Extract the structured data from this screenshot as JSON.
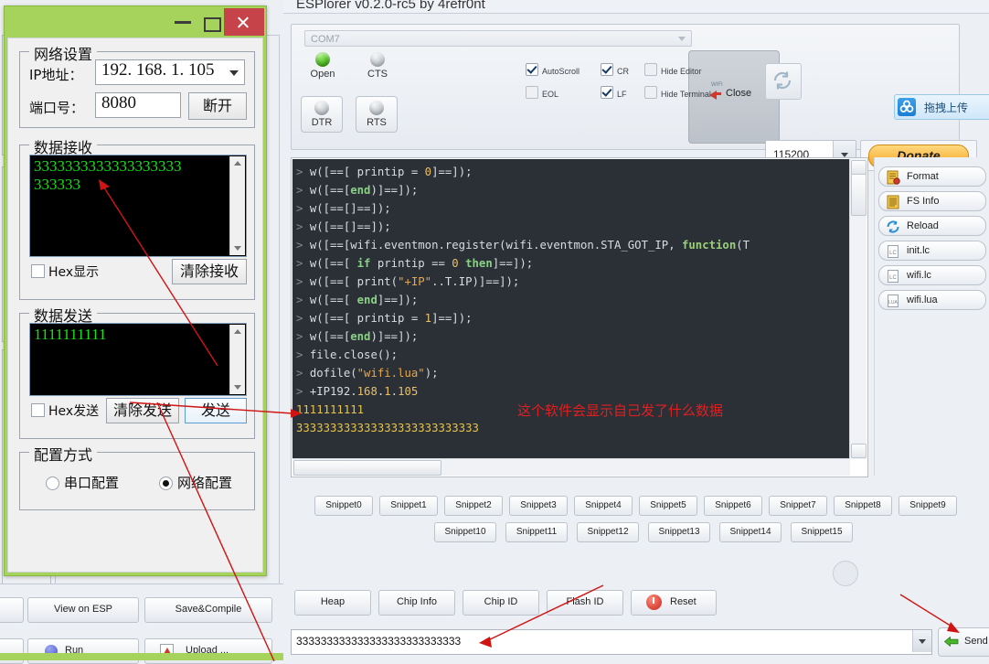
{
  "esplorer": {
    "title": "ESPlorer v0.2.0-rc5 by 4refr0nt",
    "port_select": "COM7",
    "leds": [
      {
        "name": "Open",
        "state": "green"
      },
      {
        "name": "CTS",
        "state": "grey"
      },
      {
        "name": "DTR",
        "state": "grey"
      },
      {
        "name": "RTS",
        "state": "grey"
      }
    ],
    "close_button": "Close",
    "baud": "115200",
    "donate": "Donate",
    "checkboxes": [
      {
        "label": "AutoScroll",
        "checked": true
      },
      {
        "label": "EOL",
        "checked": false
      },
      {
        "label": "CR",
        "checked": true
      },
      {
        "label": "LF",
        "checked": true
      },
      {
        "label": "Hide Editor",
        "checked": false
      },
      {
        "label": "Hide Terminal",
        "checked": false
      }
    ],
    "drag_upload": "拖拽上传",
    "file_buttons": [
      {
        "label": "Format",
        "icon": "format-icon"
      },
      {
        "label": "FS Info",
        "icon": "fsinfo-icon"
      },
      {
        "label": "Reload",
        "icon": "reload-icon"
      },
      {
        "label": "init.lc",
        "icon": "lc-file-icon"
      },
      {
        "label": "wifi.lc",
        "icon": "lc-file-icon"
      },
      {
        "label": "wifi.lua",
        "icon": "lua-file-icon"
      }
    ],
    "snippets_row1": [
      "Snippet0",
      "Snippet1",
      "Snippet2",
      "Snippet3",
      "Snippet4",
      "Snippet5",
      "Snippet6",
      "Snippet7",
      "Snippet8",
      "Snippet9"
    ],
    "snippets_row2": [
      "Snippet10",
      "Snippet11",
      "Snippet12",
      "Snippet13",
      "Snippet14",
      "Snippet15"
    ],
    "bottom_buttons": [
      "Heap",
      "Chip Info",
      "Chip ID",
      "Flash ID"
    ],
    "reset_button": "Reset",
    "send_field_value": "333333333333333333333333333",
    "send_button": "Send"
  },
  "terminal": {
    "lines": [
      {
        "prompt": ">",
        "parts": [
          {
            "t": "w([==[    printip = ",
            "c": "plain"
          },
          {
            "t": "0",
            "c": "num"
          },
          {
            "t": "]==]);",
            "c": "plain"
          }
        ]
      },
      {
        "prompt": ">",
        "parts": [
          {
            "t": "w([==[",
            "c": "plain"
          },
          {
            "t": "end",
            "c": "kw"
          },
          {
            "t": ")]==]);",
            "c": "plain"
          }
        ]
      },
      {
        "prompt": ">",
        "parts": [
          {
            "t": "w([==[]==]);",
            "c": "plain"
          }
        ]
      },
      {
        "prompt": ">",
        "parts": [
          {
            "t": "w([==[]==]);",
            "c": "plain"
          }
        ]
      },
      {
        "prompt": ">",
        "parts": [
          {
            "t": "w([==[wifi.eventmon.register(wifi.eventmon.STA_GOT_IP, ",
            "c": "plain"
          },
          {
            "t": "function",
            "c": "fn"
          },
          {
            "t": "(T",
            "c": "plain"
          }
        ]
      },
      {
        "prompt": ">",
        "parts": [
          {
            "t": "w([==[    ",
            "c": "plain"
          },
          {
            "t": "if",
            "c": "kw"
          },
          {
            "t": " printip == ",
            "c": "plain"
          },
          {
            "t": "0",
            "c": "num"
          },
          {
            "t": " ",
            "c": "plain"
          },
          {
            "t": "then",
            "c": "kw"
          },
          {
            "t": "]==]);",
            "c": "plain"
          }
        ]
      },
      {
        "prompt": ">",
        "parts": [
          {
            "t": "w([==[        print(",
            "c": "plain"
          },
          {
            "t": "\"+IP\"",
            "c": "str"
          },
          {
            "t": "..T.IP)]==]);",
            "c": "plain"
          }
        ]
      },
      {
        "prompt": ">",
        "parts": [
          {
            "t": "w([==[    ",
            "c": "plain"
          },
          {
            "t": "end",
            "c": "kw"
          },
          {
            "t": "]==]);",
            "c": "plain"
          }
        ]
      },
      {
        "prompt": ">",
        "parts": [
          {
            "t": "w([==[    printip = ",
            "c": "plain"
          },
          {
            "t": "1",
            "c": "num"
          },
          {
            "t": "]==]);",
            "c": "plain"
          }
        ]
      },
      {
        "prompt": ">",
        "parts": [
          {
            "t": "w([==[",
            "c": "plain"
          },
          {
            "t": "end",
            "c": "kw"
          },
          {
            "t": ")]==]);",
            "c": "plain"
          }
        ]
      },
      {
        "prompt": ">",
        "parts": [
          {
            "t": "file.close();",
            "c": "plain"
          }
        ]
      },
      {
        "prompt": ">",
        "parts": [
          {
            "t": "dofile(",
            "c": "plain"
          },
          {
            "t": "\"wifi.lua\"",
            "c": "str"
          },
          {
            "t": ");",
            "c": "plain"
          }
        ]
      },
      {
        "prompt": ">",
        "parts": [
          {
            "t": "+IP192.",
            "c": "plain"
          },
          {
            "t": "168",
            "c": "num"
          },
          {
            "t": ".",
            "c": "plain"
          },
          {
            "t": "1",
            "c": "num"
          },
          {
            "t": ".",
            "c": "plain"
          },
          {
            "t": "105",
            "c": "num"
          }
        ]
      },
      {
        "prompt": "",
        "parts": [
          {
            "t": "1111111111",
            "c": "sent"
          }
        ]
      },
      {
        "prompt": "",
        "parts": [
          {
            "t": "333333333333333333333333333",
            "c": "sent"
          }
        ]
      }
    ]
  },
  "editor_buttons": {
    "view_on_esp": "View on ESP",
    "save_compile": "Save&Compile",
    "run": "Run",
    "upload": "Upload ..."
  },
  "serial_tool": {
    "window_controls": {
      "minimize": "minimize-icon",
      "maximize": "maximize-icon",
      "close": "close-icon"
    },
    "net_group": {
      "title": "网络设置",
      "ip_label": "IP地址：",
      "ip_value": "192. 168. 1. 105",
      "port_label": "端口号：",
      "port_value": "8080",
      "disconnect_button": "断开"
    },
    "recv_group": {
      "title": "数据接收",
      "content_line1": "3333333333333333333",
      "content_line2": "333333",
      "hex_checkbox": "Hex显示",
      "clear_button": "清除接收"
    },
    "send_group": {
      "title": "数据发送",
      "content": "1111111111",
      "hex_checkbox": "Hex发送",
      "clear_button": "清除发送",
      "send_button": "发送"
    },
    "config_group": {
      "title": "配置方式",
      "option_serial": "串口配置",
      "option_network": "网络配置",
      "selected": "网络配置"
    }
  },
  "annotation": {
    "text": "这个软件会显示自己发了什么数据",
    "color": "#e02020"
  }
}
